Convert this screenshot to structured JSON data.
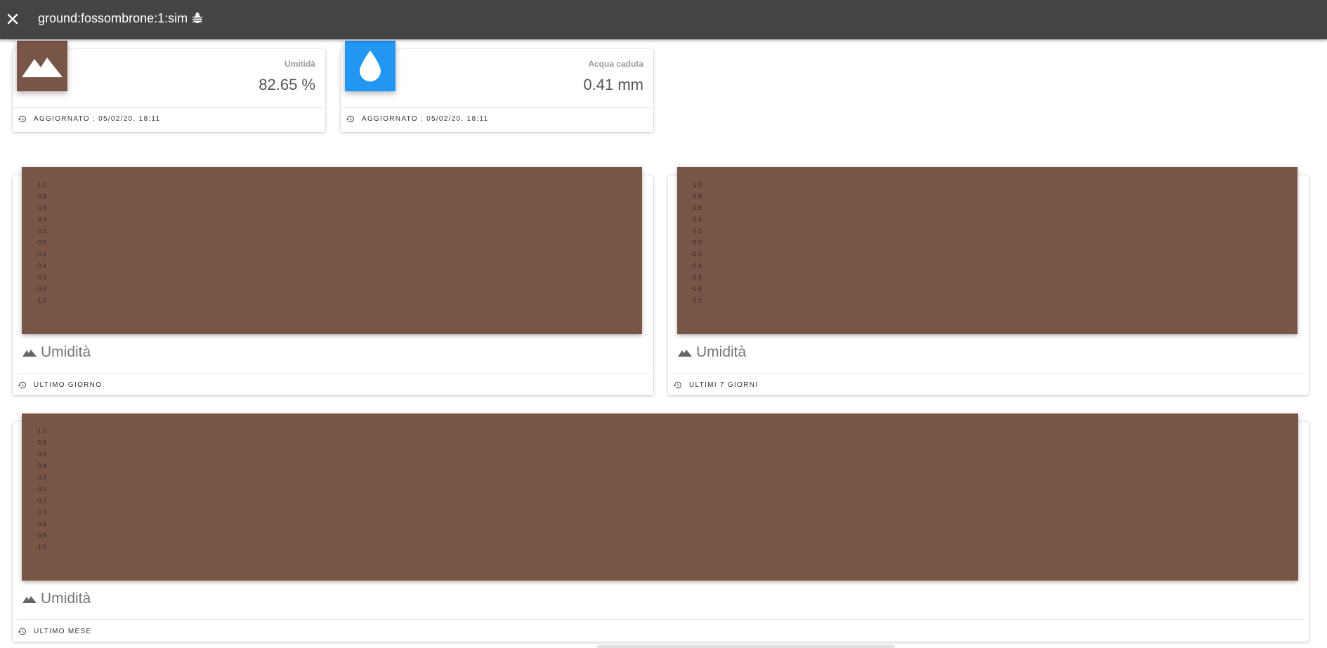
{
  "header": {
    "title": "ground:fossombrone:1:sim",
    "close_icon": "close-icon",
    "bug_icon": "bug-icon"
  },
  "stats": [
    {
      "category": "Umitidà",
      "value": "82.65 %",
      "footer": "AGGIORNATO : 05/02/20, 18:11",
      "icon": "terrain-icon",
      "color": "#795548"
    },
    {
      "category": "Acqua caduta",
      "value": "0.41 mm",
      "footer": "AGGIORNATO : 05/02/20, 18:11",
      "icon": "water-drop-icon",
      "color": "#2196f3"
    }
  ],
  "charts": [
    {
      "title": "Umidità",
      "footer": "ULTIMO GIORNO",
      "y_ticks": [
        "1.0",
        "0.8",
        "0.6",
        "0.4",
        "0.2",
        "-0.0",
        "-0.2",
        "-0.4",
        "-0.6",
        "-0.8",
        "-1.0"
      ]
    },
    {
      "title": "Umidità",
      "footer": "ULTIMI 7 GIORNI",
      "y_ticks": [
        "1.0",
        "0.8",
        "0.6",
        "0.4",
        "0.2",
        "-0.0",
        "-0.2",
        "-0.4",
        "-0.6",
        "-0.8",
        "-1.0"
      ]
    },
    {
      "title": "Umidità",
      "footer": "ULTIMO MESE",
      "y_ticks": [
        "1.0",
        "0.8",
        "0.6",
        "0.4",
        "0.2",
        "-0.0",
        "-0.2",
        "-0.4",
        "-0.6",
        "-0.8",
        "-1.0"
      ]
    }
  ],
  "chart_data": [
    {
      "type": "line",
      "ylim": [
        -1.0,
        1.0
      ],
      "y_ticks": [
        1.0,
        0.8,
        0.6,
        0.4,
        0.2,
        -0.0,
        -0.2,
        -0.4,
        -0.6,
        -0.8,
        -1.0
      ],
      "series": []
    },
    {
      "type": "line",
      "ylim": [
        -1.0,
        1.0
      ],
      "y_ticks": [
        1.0,
        0.8,
        0.6,
        0.4,
        0.2,
        -0.0,
        -0.2,
        -0.4,
        -0.6,
        -0.8,
        -1.0
      ],
      "series": []
    },
    {
      "type": "line",
      "ylim": [
        -1.0,
        1.0
      ],
      "y_ticks": [
        1.0,
        0.8,
        0.6,
        0.4,
        0.2,
        -0.0,
        -0.2,
        -0.4,
        -0.6,
        -0.8,
        -1.0
      ],
      "series": []
    }
  ],
  "colors": {
    "header_bg": "#444444",
    "chart_bg": "#795548",
    "accent_blue": "#2196f3"
  }
}
